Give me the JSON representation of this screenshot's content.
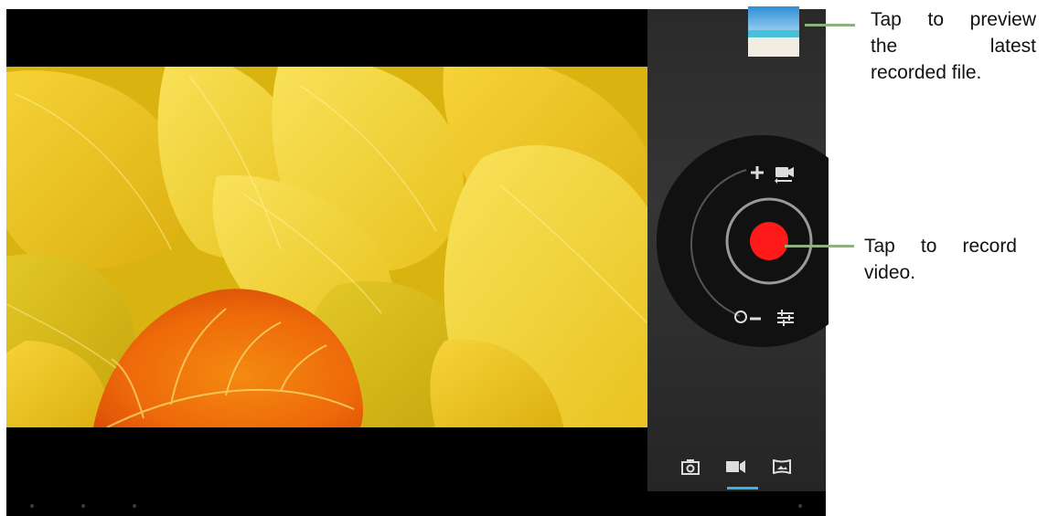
{
  "callouts": {
    "preview": {
      "line1": "Tap to preview",
      "line2": "the latest",
      "line3": "recorded file."
    },
    "record": {
      "line1": "Tap to record",
      "line2": "video."
    }
  },
  "camera": {
    "dial_controls": [
      "zoom-in",
      "switch-camera",
      "zoom-out",
      "settings"
    ],
    "active_mode": "video",
    "modes": [
      "photo",
      "video",
      "panorama"
    ]
  },
  "colors": {
    "record": "#ff1a1a",
    "mode_indicator": "#33b5e5",
    "callout_line": "#8fb07f"
  }
}
